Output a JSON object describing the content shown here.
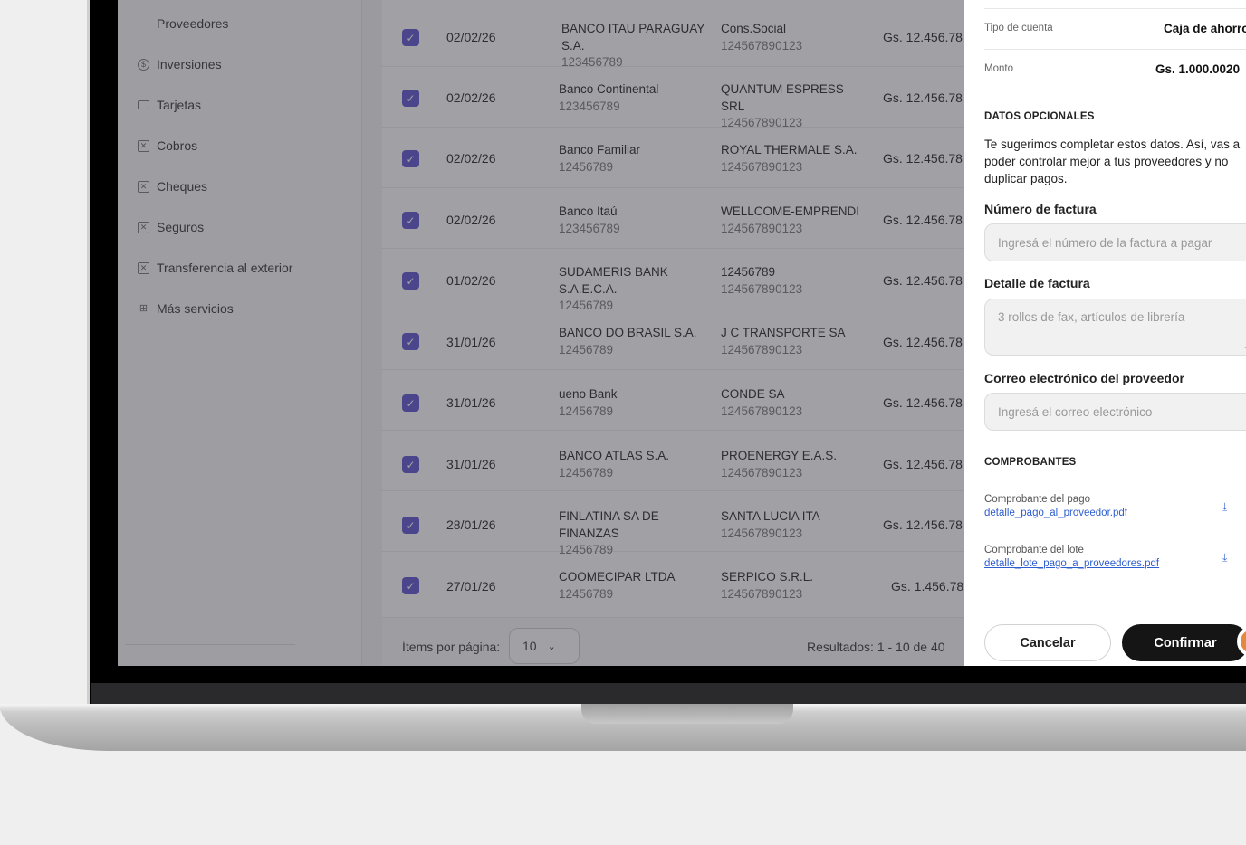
{
  "sidebar": {
    "items": [
      {
        "label": "Proveedores",
        "icon": "none"
      },
      {
        "label": "Inversiones",
        "icon": "currency-icon"
      },
      {
        "label": "Tarjetas",
        "icon": "card-icon"
      },
      {
        "label": "Cobros",
        "icon": "box-icon"
      },
      {
        "label": "Cheques",
        "icon": "box-icon"
      },
      {
        "label": "Seguros",
        "icon": "box-icon"
      },
      {
        "label": "Transferencia al exterior",
        "icon": "box-icon"
      },
      {
        "label": "Más servicios",
        "icon": "grid-icon"
      }
    ]
  },
  "table": {
    "rows": [
      {
        "date": "02/02/26",
        "bank": "BANCO ITAU PARAGUAY S.A.",
        "bank_id": "123456789",
        "provider": "Cons.Social",
        "provider_id": "124567890123",
        "amount": "Gs. 12.456.78"
      },
      {
        "date": "02/02/26",
        "bank": "Banco Continental",
        "bank_id": "123456789",
        "provider": "QUANTUM ESPRESS SRL",
        "provider_id": "124567890123",
        "amount": "Gs. 12.456.78"
      },
      {
        "date": "02/02/26",
        "bank": "Banco Familiar",
        "bank_id": "12456789",
        "provider": "ROYAL THERMALE S.A.",
        "provider_id": "124567890123",
        "amount": "Gs. 12.456.78"
      },
      {
        "date": "02/02/26",
        "bank": "Banco Itaú",
        "bank_id": "123456789",
        "provider": "WELLCOME-EMPRENDI",
        "provider_id": "124567890123",
        "amount": "Gs. 12.456.78"
      },
      {
        "date": "01/02/26",
        "bank": "SUDAMERIS BANK S.A.E.C.A.",
        "bank_id": "12456789",
        "provider": "12456789",
        "provider_id": "124567890123",
        "amount": "Gs. 12.456.78"
      },
      {
        "date": "31/01/26",
        "bank": "BANCO DO BRASIL S.A.",
        "bank_id": "12456789",
        "provider": "J C TRANSPORTE SA",
        "provider_id": "124567890123",
        "amount": "Gs. 12.456.78"
      },
      {
        "date": "31/01/26",
        "bank": "ueno Bank",
        "bank_id": "12456789",
        "provider": "CONDE SA",
        "provider_id": "124567890123",
        "amount": "Gs. 12.456.78"
      },
      {
        "date": "31/01/26",
        "bank": "BANCO ATLAS S.A.",
        "bank_id": "12456789",
        "provider": "PROENERGY E.A.S.",
        "provider_id": "124567890123",
        "amount": "Gs. 12.456.78"
      },
      {
        "date": "28/01/26",
        "bank": "FINLATINA SA DE FINANZAS",
        "bank_id": "12456789",
        "provider": "SANTA LUCIA ITA",
        "provider_id": "124567890123",
        "amount": "Gs. 12.456.78"
      },
      {
        "date": "27/01/26",
        "bank": "COOMECIPAR LTDA",
        "bank_id": "12456789",
        "provider": "SERPICO S.R.L.",
        "provider_id": "124567890123",
        "amount": "Gs. 1.456.78"
      }
    ],
    "pager": {
      "items_label": "Ítems por página:",
      "per_page": "10",
      "results": "Resultados: 1 - 10 de 40"
    }
  },
  "drawer": {
    "account_type_label": "Tipo de cuenta",
    "account_type_value": "Caja de ahorro",
    "amount_label": "Monto",
    "amount_value": "Gs. 1.000.0020",
    "optional_title": "DATOS OPCIONALES",
    "optional_helper": "Te sugerimos completar estos datos. Así, vas a poder controlar mejor a tus proveedores y no duplicar pagos.",
    "invoice_number_label": "Número de factura",
    "invoice_number_placeholder": "Ingresá el número de la factura a pagar",
    "invoice_detail_label": "Detalle de factura",
    "invoice_detail_placeholder": "3 rollos de fax, artículos de librería",
    "email_label": "Correo electrónico del proveedor",
    "email_placeholder": "Ingresá el correo electrónico",
    "receipts_title": "COMPROBANTES",
    "receipts": [
      {
        "caption": "Comprobante del pago",
        "file": "detalle_pago_al_proveedor.pdf"
      },
      {
        "caption": "Comprobante del lote",
        "file": "detalle_lote_pago_a_proveedores.pdf"
      }
    ],
    "cancel_label": "Cancelar",
    "confirm_label": "Confirmar"
  },
  "colors": {
    "accent": "#5b4fd0",
    "confirm": "#151515",
    "link": "#2f5ecf",
    "cursor": "#e58a3d"
  }
}
